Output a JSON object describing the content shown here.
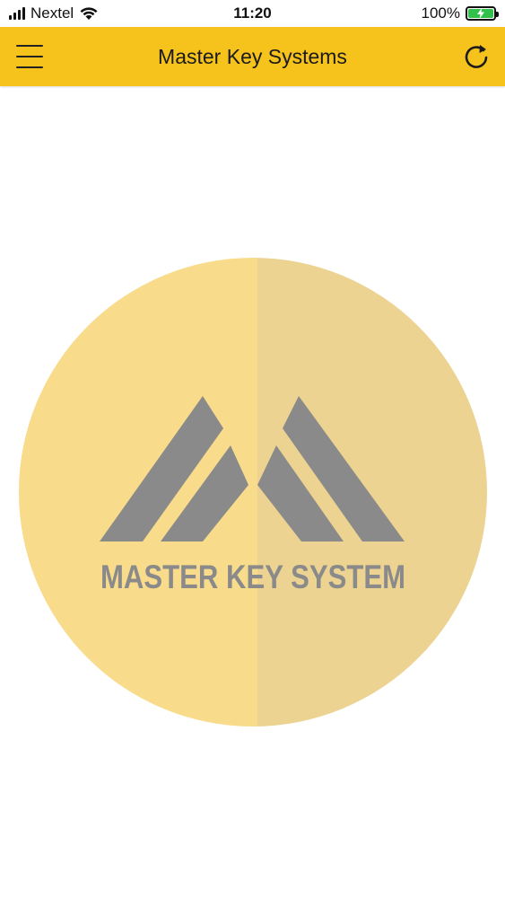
{
  "status_bar": {
    "carrier": "Nextel",
    "time": "11:20",
    "battery_percent": "100%",
    "icons": [
      "signal-icon",
      "wifi-icon",
      "battery-charging-icon"
    ]
  },
  "app_bar": {
    "title": "Master Key Systems",
    "left_icon": "hamburger-menu-icon",
    "right_icon": "refresh-icon",
    "color": "#f6c21c"
  },
  "logo": {
    "text": "MASTER KEY SYSTEM",
    "circle_color_left": "#f8dc8c",
    "circle_color_right": "#ecd391",
    "mark_color": "#8a8a8a"
  }
}
